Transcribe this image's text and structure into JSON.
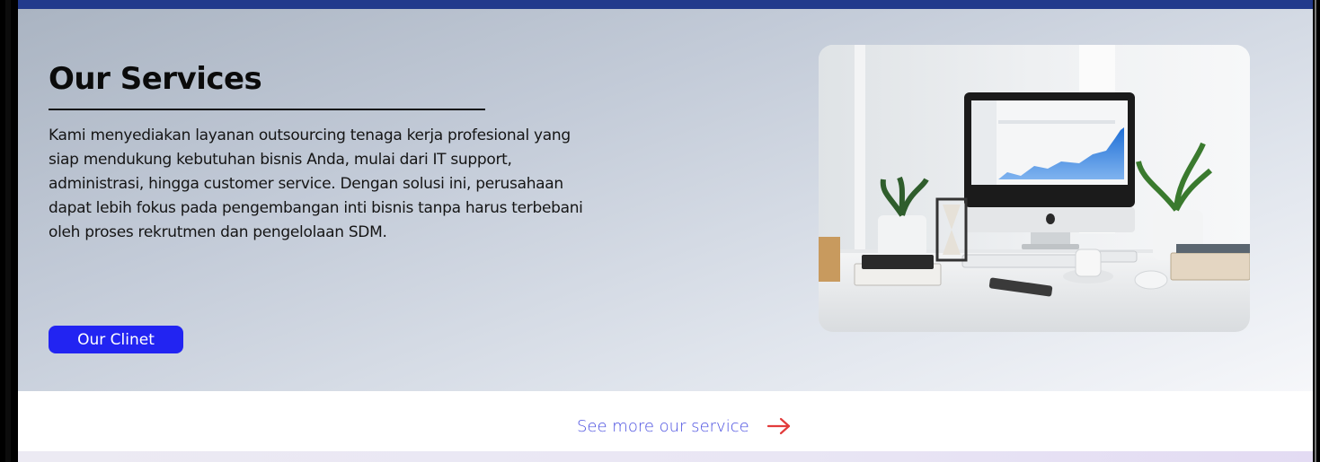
{
  "services": {
    "title": "Our Services",
    "description": "Kami menyediakan layanan outsourcing tenaga kerja profesional yang siap mendukung kebutuhan bisnis Anda, mulai dari IT support, administrasi, hingga customer service. Dengan solusi ini, perusahaan dapat lebih fokus pada pengembangan inti bisnis tanpa harus terbebani oleh proses rekrutmen dan pengelolaan SDM.",
    "cta_label": "Our Clinet"
  },
  "see_more": {
    "label": "See more our service",
    "icon": "arrow-right-icon"
  },
  "colors": {
    "top_bar": "#223a8c",
    "cta_background": "#2224f2",
    "link_text": "#4a4fe0",
    "arrow": "#e23b3b"
  }
}
